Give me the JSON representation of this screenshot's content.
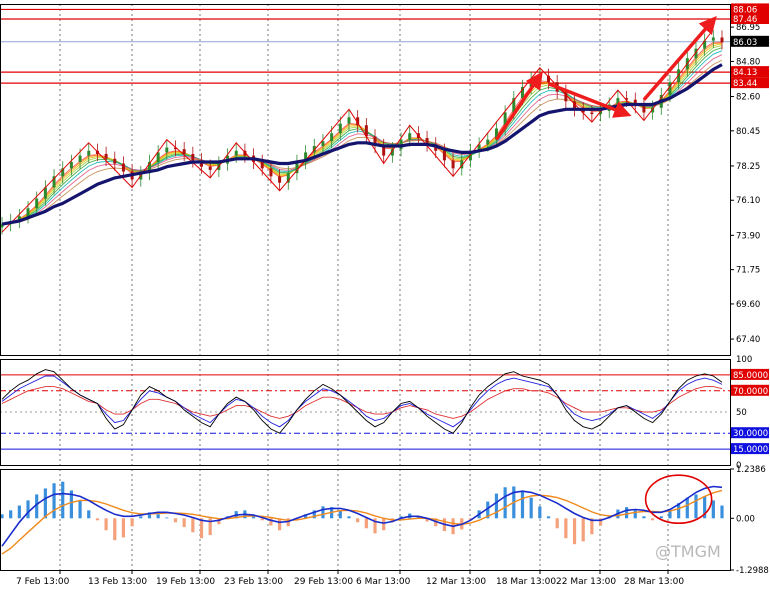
{
  "chart_data": [
    {
      "type": "line",
      "panel": "price",
      "yticks": [
        "88.06",
        "87.46",
        "86.95",
        "86.03",
        "84.80",
        "84.13",
        "83.44",
        "82.60",
        "80.45",
        "78.25",
        "76.10",
        "73.90",
        "71.75",
        "69.60",
        "67.40"
      ],
      "tagged_levels": [
        {
          "label": "88.06",
          "value": 88.06,
          "color": "#e00000"
        },
        {
          "label": "87.46",
          "value": 87.46,
          "color": "#e00000"
        },
        {
          "label": "86.03",
          "value": 86.03,
          "color": "#000000"
        },
        {
          "label": "84.13",
          "value": 84.13,
          "color": "#e00000"
        },
        {
          "label": "83.44",
          "value": 83.44,
          "color": "#e00000"
        }
      ],
      "ylim": [
        66.4,
        88.4
      ],
      "close": [
        74.6,
        74.8,
        75.1,
        75.6,
        76.2,
        76.9,
        77.6,
        78.1,
        78.5,
        78.9,
        79.2,
        79.0,
        78.7,
        78.4,
        77.9,
        77.4,
        77.8,
        78.5,
        79.1,
        79.4,
        79.3,
        79.0,
        78.6,
        78.2,
        78.0,
        78.4,
        78.9,
        79.2,
        78.9,
        78.5,
        78.1,
        77.6,
        77.2,
        77.8,
        78.5,
        79.1,
        79.5,
        79.8,
        80.3,
        80.9,
        81.3,
        80.8,
        80.1,
        79.5,
        78.9,
        79.3,
        79.9,
        80.3,
        80.0,
        79.6,
        79.2,
        78.6,
        78.1,
        78.6,
        79.2,
        79.6,
        79.9,
        80.6,
        81.6,
        82.5,
        83.2,
        83.7,
        83.9,
        83.5,
        82.9,
        82.3,
        81.8,
        81.6,
        81.5,
        81.7,
        82.1,
        82.5,
        82.4,
        82.0,
        81.6,
        81.9,
        82.7,
        83.5,
        84.3,
        85.0,
        85.6,
        86.1,
        86.3,
        86.0
      ],
      "ma_thick": [
        74.6,
        74.7,
        74.8,
        75.0,
        75.2,
        75.4,
        75.7,
        75.9,
        76.2,
        76.5,
        76.8,
        77.1,
        77.3,
        77.5,
        77.6,
        77.7,
        77.8,
        77.9,
        78.0,
        78.2,
        78.3,
        78.4,
        78.5,
        78.5,
        78.5,
        78.5,
        78.6,
        78.7,
        78.7,
        78.7,
        78.6,
        78.5,
        78.4,
        78.4,
        78.5,
        78.6,
        78.8,
        79.0,
        79.2,
        79.4,
        79.6,
        79.7,
        79.7,
        79.6,
        79.5,
        79.5,
        79.5,
        79.6,
        79.6,
        79.6,
        79.5,
        79.3,
        79.2,
        79.1,
        79.1,
        79.2,
        79.3,
        79.5,
        79.8,
        80.2,
        80.6,
        81.0,
        81.4,
        81.6,
        81.7,
        81.8,
        81.8,
        81.8,
        81.8,
        81.8,
        81.9,
        82.0,
        82.1,
        82.1,
        82.1,
        82.1,
        82.3,
        82.5,
        82.8,
        83.1,
        83.5,
        83.9,
        84.3,
        84.6
      ],
      "arrows": [
        {
          "from": [
            57,
            79.9
          ],
          "to": [
            62,
            83.9
          ]
        },
        {
          "from": [
            63,
            83.4
          ],
          "to": [
            72,
            81.5
          ]
        },
        {
          "from": [
            74,
            82.4
          ],
          "to": [
            82,
            87.4
          ]
        }
      ]
    },
    {
      "type": "line",
      "panel": "oscillator",
      "yticks": [
        "100",
        "85.0000",
        "70.0000",
        "50",
        "30.0000",
        "15.0000",
        "0"
      ],
      "tagged_levels": [
        {
          "label": "85.0000",
          "value": 85,
          "color": "#e00000"
        },
        {
          "label": "70.0000",
          "value": 70,
          "color": "#e00000"
        },
        {
          "label": "30.0000",
          "value": 30,
          "color": "#1010e0"
        },
        {
          "label": "15.0000",
          "value": 15,
          "color": "#1010e0"
        }
      ],
      "ylim": [
        0,
        100
      ],
      "line_black": [
        62,
        70,
        76,
        80,
        86,
        90,
        88,
        80,
        72,
        66,
        62,
        58,
        44,
        34,
        38,
        52,
        66,
        74,
        70,
        64,
        60,
        52,
        46,
        40,
        36,
        48,
        58,
        64,
        60,
        52,
        42,
        34,
        30,
        40,
        52,
        62,
        70,
        76,
        72,
        66,
        58,
        50,
        42,
        36,
        40,
        50,
        58,
        60,
        54,
        46,
        40,
        34,
        30,
        40,
        54,
        66,
        74,
        80,
        86,
        88,
        84,
        82,
        80,
        76,
        66,
        52,
        42,
        36,
        34,
        38,
        46,
        54,
        56,
        50,
        44,
        40,
        48,
        60,
        72,
        80,
        84,
        86,
        84,
        78
      ],
      "line_blue": [
        60,
        66,
        72,
        76,
        80,
        84,
        84,
        78,
        72,
        66,
        62,
        58,
        48,
        40,
        42,
        52,
        62,
        70,
        68,
        64,
        60,
        54,
        48,
        44,
        40,
        48,
        56,
        62,
        60,
        54,
        46,
        40,
        36,
        42,
        52,
        60,
        66,
        72,
        70,
        66,
        60,
        54,
        46,
        42,
        44,
        50,
        56,
        58,
        54,
        48,
        44,
        40,
        36,
        42,
        52,
        62,
        70,
        76,
        80,
        82,
        80,
        78,
        76,
        74,
        66,
        56,
        48,
        44,
        42,
        44,
        48,
        54,
        56,
        52,
        48,
        44,
        50,
        60,
        70,
        76,
        80,
        82,
        80,
        76
      ],
      "line_red": [
        58,
        62,
        66,
        70,
        72,
        74,
        74,
        72,
        68,
        64,
        60,
        58,
        52,
        48,
        48,
        52,
        58,
        62,
        62,
        60,
        58,
        54,
        50,
        48,
        46,
        48,
        52,
        56,
        56,
        54,
        50,
        46,
        44,
        46,
        50,
        56,
        60,
        64,
        64,
        62,
        58,
        54,
        50,
        48,
        48,
        50,
        54,
        56,
        54,
        52,
        48,
        46,
        44,
        46,
        50,
        56,
        62,
        66,
        70,
        72,
        72,
        70,
        70,
        68,
        64,
        58,
        54,
        50,
        50,
        50,
        52,
        54,
        54,
        52,
        50,
        50,
        52,
        58,
        64,
        68,
        72,
        74,
        74,
        72
      ]
    },
    {
      "type": "bar",
      "panel": "macd",
      "yticks": [
        "1.2386",
        "0.00",
        "-1.2988"
      ],
      "ylim": [
        -1.2988,
        1.2386
      ],
      "histogram": [
        0.1,
        0.2,
        0.32,
        0.45,
        0.6,
        0.75,
        0.88,
        0.92,
        0.7,
        0.45,
        0.2,
        -0.05,
        -0.3,
        -0.55,
        -0.48,
        -0.2,
        0.05,
        0.15,
        0.1,
        0.02,
        -0.1,
        -0.22,
        -0.35,
        -0.5,
        -0.42,
        -0.15,
        0.05,
        0.18,
        0.2,
        0.08,
        -0.05,
        -0.18,
        -0.3,
        -0.2,
        -0.05,
        0.1,
        0.2,
        0.3,
        0.28,
        0.18,
        0.05,
        -0.1,
        -0.25,
        -0.38,
        -0.3,
        -0.1,
        0.05,
        0.12,
        0.05,
        -0.08,
        -0.2,
        -0.32,
        -0.4,
        -0.28,
        -0.05,
        0.2,
        0.42,
        0.62,
        0.78,
        0.8,
        0.7,
        0.52,
        0.3,
        0.05,
        -0.25,
        -0.5,
        -0.65,
        -0.58,
        -0.4,
        -0.18,
        0.05,
        0.22,
        0.28,
        0.2,
        0.05,
        -0.05,
        0.05,
        0.2,
        0.38,
        0.52,
        0.6,
        0.55,
        0.45,
        0.32
      ],
      "macd_line": [
        -0.7,
        -0.4,
        -0.1,
        0.15,
        0.35,
        0.5,
        0.6,
        0.62,
        0.6,
        0.55,
        0.45,
        0.32,
        0.2,
        0.1,
        0.05,
        0.05,
        0.08,
        0.12,
        0.15,
        0.15,
        0.12,
        0.08,
        0.02,
        -0.05,
        -0.08,
        -0.05,
        0.02,
        0.08,
        0.1,
        0.08,
        0.02,
        -0.05,
        -0.1,
        -0.08,
        0.0,
        0.08,
        0.15,
        0.22,
        0.25,
        0.25,
        0.2,
        0.12,
        0.02,
        -0.08,
        -0.12,
        -0.08,
        0.0,
        0.05,
        0.05,
        0.0,
        -0.08,
        -0.15,
        -0.2,
        -0.15,
        -0.05,
        0.1,
        0.25,
        0.4,
        0.55,
        0.65,
        0.68,
        0.65,
        0.58,
        0.48,
        0.38,
        0.25,
        0.12,
        0.02,
        -0.05,
        -0.05,
        0.02,
        0.12,
        0.2,
        0.22,
        0.2,
        0.15,
        0.15,
        0.22,
        0.35,
        0.5,
        0.65,
        0.75,
        0.8,
        0.78
      ],
      "signal_line": [
        -0.9,
        -0.75,
        -0.55,
        -0.35,
        -0.15,
        0.05,
        0.2,
        0.32,
        0.4,
        0.45,
        0.45,
        0.42,
        0.36,
        0.28,
        0.2,
        0.14,
        0.11,
        0.11,
        0.12,
        0.13,
        0.13,
        0.12,
        0.1,
        0.06,
        0.02,
        -0.01,
        -0.01,
        0.02,
        0.05,
        0.06,
        0.05,
        0.02,
        -0.02,
        -0.05,
        -0.04,
        0.0,
        0.05,
        0.1,
        0.15,
        0.19,
        0.2,
        0.18,
        0.13,
        0.06,
        0.0,
        -0.04,
        -0.04,
        -0.02,
        0.0,
        0.0,
        -0.03,
        -0.08,
        -0.13,
        -0.15,
        -0.12,
        -0.05,
        0.05,
        0.15,
        0.28,
        0.4,
        0.5,
        0.56,
        0.58,
        0.56,
        0.52,
        0.45,
        0.36,
        0.26,
        0.16,
        0.09,
        0.06,
        0.07,
        0.11,
        0.15,
        0.17,
        0.17,
        0.16,
        0.18,
        0.24,
        0.33,
        0.44,
        0.55,
        0.64,
        0.7
      ]
    }
  ],
  "xaxis": {
    "labels": [
      "7 Feb 13:00",
      "13 Feb 13:00",
      "19 Feb 13:00",
      "23 Feb 13:00",
      "29 Feb 13:00",
      "6 Mar 13:00",
      "12 Mar 13:00",
      "18 Mar 13:00",
      "22 Mar 13:00",
      "28 Mar 13:00"
    ]
  },
  "watermark": "@TMGM",
  "colors": {
    "level_red": "#e00000",
    "ma_thick": "#14146e",
    "arrow": "#ee1c1c",
    "hist_pos": "#3a8fdc",
    "hist_neg": "#f4a07a",
    "macd_line": "#1a2ccc",
    "signal_line": "#f08a1c",
    "zigzag": "#e00000",
    "circle": "#e00000"
  }
}
